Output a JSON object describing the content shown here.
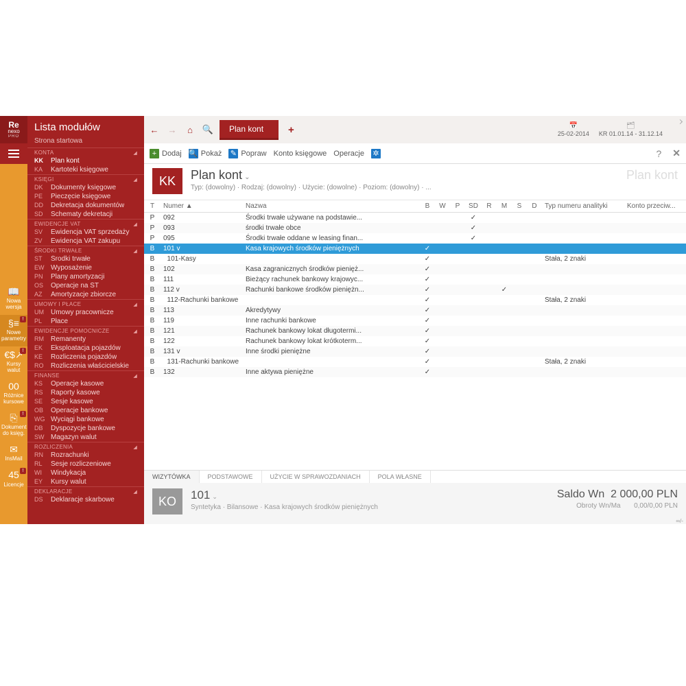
{
  "brand": {
    "name": "Re",
    "line2": "nexo",
    "line3": "PRO"
  },
  "rail": [
    {
      "glyph": "📖",
      "label": "Nowa wersja",
      "badge": false
    },
    {
      "glyph": "§≡",
      "label": "Nowe parametry",
      "badge": true,
      "sel": true
    },
    {
      "glyph": "€$↗",
      "label": "Kursy walut",
      "badge": true
    },
    {
      "glyph": "00",
      "label": "Różnice kursowe",
      "badge": false
    },
    {
      "glyph": "⎘",
      "label": "Dokument do księg.",
      "badge": true
    },
    {
      "glyph": "✉",
      "label": "InsMail",
      "badge": false
    },
    {
      "glyph": "45",
      "label": "Licencje",
      "badge": true
    }
  ],
  "modules": {
    "title": "Lista modułów",
    "start": "Strona startowa",
    "groups": [
      {
        "name": "KONTA",
        "items": [
          {
            "code": "KK",
            "name": "Plan kont",
            "active": true
          },
          {
            "code": "KA",
            "name": "Kartoteki księgowe"
          }
        ]
      },
      {
        "name": "KSIĘGI",
        "items": [
          {
            "code": "DK",
            "name": "Dokumenty księgowe"
          },
          {
            "code": "PE",
            "name": "Pieczęcie księgowe"
          },
          {
            "code": "DD",
            "name": "Dekretacja dokumentów"
          },
          {
            "code": "SD",
            "name": "Schematy dekretacji"
          }
        ]
      },
      {
        "name": "EWIDENCJE VAT",
        "items": [
          {
            "code": "SV",
            "name": "Ewidencja VAT sprzedaży"
          },
          {
            "code": "ZV",
            "name": "Ewidencja VAT zakupu"
          }
        ]
      },
      {
        "name": "ŚRODKI TRWAŁE",
        "items": [
          {
            "code": "ST",
            "name": "Środki trwałe"
          },
          {
            "code": "EW",
            "name": "Wyposażenie"
          },
          {
            "code": "PN",
            "name": "Plany amortyzacji"
          },
          {
            "code": "OS",
            "name": "Operacje na ŚT"
          },
          {
            "code": "AZ",
            "name": "Amortyzacje zbiorcze"
          }
        ]
      },
      {
        "name": "UMOWY I PŁACE",
        "items": [
          {
            "code": "UM",
            "name": "Umowy pracownicze"
          },
          {
            "code": "PL",
            "name": "Płace"
          }
        ]
      },
      {
        "name": "EWIDENCJE POMOCNICZE",
        "items": [
          {
            "code": "RM",
            "name": "Remanenty"
          },
          {
            "code": "EK",
            "name": "Eksploatacja pojazdów"
          },
          {
            "code": "KE",
            "name": "Rozliczenia pojazdów"
          },
          {
            "code": "RO",
            "name": "Rozliczenia właścicielskie"
          }
        ]
      },
      {
        "name": "FINANSE",
        "items": [
          {
            "code": "KS",
            "name": "Operacje kasowe"
          },
          {
            "code": "RS",
            "name": "Raporty kasowe"
          },
          {
            "code": "SE",
            "name": "Sesje kasowe"
          },
          {
            "code": "OB",
            "name": "Operacje bankowe"
          },
          {
            "code": "WG",
            "name": "Wyciągi bankowe"
          },
          {
            "code": "DB",
            "name": "Dyspozycje bankowe"
          },
          {
            "code": "SW",
            "name": "Magazyn walut"
          }
        ]
      },
      {
        "name": "ROZLICZENIA",
        "items": [
          {
            "code": "RN",
            "name": "Rozrachunki"
          },
          {
            "code": "RL",
            "name": "Sesje rozliczeniowe"
          },
          {
            "code": "WI",
            "name": "Windykacja"
          },
          {
            "code": "EY",
            "name": "Kursy walut"
          }
        ]
      },
      {
        "name": "DEKLARACJE",
        "items": [
          {
            "code": "DS",
            "name": "Deklaracje skarbowe"
          }
        ]
      }
    ]
  },
  "topbar": {
    "tab": "Plan kont",
    "date": "25-02-2014",
    "period": "KR  01.01.14 - 31.12.14"
  },
  "toolbar": {
    "add": "Dodaj",
    "show": "Pokaż",
    "fix": "Popraw",
    "konto": "Konto księgowe",
    "oper": "Operacje"
  },
  "header": {
    "badge": "KK",
    "title": "Plan kont",
    "sub": "Typ: (dowolny) · Rodzaj: (dowolny) · Użycie: (dowolne) · Poziom: (dowolny) · ...",
    "ghost": "Plan kont"
  },
  "columns": [
    "T",
    "Numer ▲",
    "Nazwa",
    "B",
    "W",
    "P",
    "SD",
    "R",
    "M",
    "S",
    "D",
    "Typ numeru analityki",
    "Konto przeciw..."
  ],
  "rows": [
    {
      "t": "P",
      "num": "092",
      "name": "Środki trwałe używane na podstawie...",
      "b": "",
      "w": "",
      "p": "",
      "sd": "✓",
      "r": "",
      "m": "",
      "s": "",
      "d": "",
      "typ": "",
      "kp": ""
    },
    {
      "t": "P",
      "num": "093",
      "name": "środki trwałe obce",
      "b": "",
      "w": "",
      "p": "",
      "sd": "✓",
      "r": "",
      "m": "",
      "s": "",
      "d": "",
      "typ": "",
      "kp": ""
    },
    {
      "t": "P",
      "num": "095",
      "name": "Środki trwałe oddane w leasing finan...",
      "b": "",
      "w": "",
      "p": "",
      "sd": "✓",
      "r": "",
      "m": "",
      "s": "",
      "d": "",
      "typ": "",
      "kp": ""
    },
    {
      "t": "B",
      "num": "101 v",
      "name": "Kasa krajowych środków pieniężnych",
      "b": "✓",
      "w": "",
      "p": "",
      "sd": "",
      "r": "",
      "m": "",
      "s": "",
      "d": "",
      "typ": "",
      "kp": "",
      "sel": true
    },
    {
      "t": "B",
      "num": "  101-Kasy",
      "name": "",
      "b": "✓",
      "w": "",
      "p": "",
      "sd": "",
      "r": "",
      "m": "",
      "s": "",
      "d": "",
      "typ": "Stała, 2 znaki",
      "kp": ""
    },
    {
      "t": "B",
      "num": "102",
      "name": "Kasa zagranicznych środków pienięż...",
      "b": "✓",
      "w": "",
      "p": "",
      "sd": "",
      "r": "",
      "m": "",
      "s": "",
      "d": "",
      "typ": "",
      "kp": ""
    },
    {
      "t": "B",
      "num": "111",
      "name": "Bieżący rachunek bankowy krajowyc...",
      "b": "✓",
      "w": "",
      "p": "",
      "sd": "",
      "r": "",
      "m": "",
      "s": "",
      "d": "",
      "typ": "",
      "kp": ""
    },
    {
      "t": "B",
      "num": "112 v",
      "name": "Rachunki bankowe środków pieniężn...",
      "b": "✓",
      "w": "",
      "p": "",
      "sd": "",
      "r": "",
      "m": "✓",
      "s": "",
      "d": "",
      "typ": "",
      "kp": ""
    },
    {
      "t": "B",
      "num": "  112-Rachunki bankowe",
      "name": "",
      "b": "✓",
      "w": "",
      "p": "",
      "sd": "",
      "r": "",
      "m": "",
      "s": "",
      "d": "",
      "typ": "Stała, 2 znaki",
      "kp": ""
    },
    {
      "t": "B",
      "num": "113",
      "name": "Akredytywy",
      "b": "✓",
      "w": "",
      "p": "",
      "sd": "",
      "r": "",
      "m": "",
      "s": "",
      "d": "",
      "typ": "",
      "kp": ""
    },
    {
      "t": "B",
      "num": "119",
      "name": "Inne rachunki bankowe",
      "b": "✓",
      "w": "",
      "p": "",
      "sd": "",
      "r": "",
      "m": "",
      "s": "",
      "d": "",
      "typ": "",
      "kp": ""
    },
    {
      "t": "B",
      "num": "121",
      "name": "Rachunek bankowy lokat długotermi...",
      "b": "✓",
      "w": "",
      "p": "",
      "sd": "",
      "r": "",
      "m": "",
      "s": "",
      "d": "",
      "typ": "",
      "kp": ""
    },
    {
      "t": "B",
      "num": "122",
      "name": "Rachunek bankowy lokat krótkoterm...",
      "b": "✓",
      "w": "",
      "p": "",
      "sd": "",
      "r": "",
      "m": "",
      "s": "",
      "d": "",
      "typ": "",
      "kp": ""
    },
    {
      "t": "B",
      "num": "131 v",
      "name": "Inne środki pieniężne",
      "b": "✓",
      "w": "",
      "p": "",
      "sd": "",
      "r": "",
      "m": "",
      "s": "",
      "d": "",
      "typ": "",
      "kp": ""
    },
    {
      "t": "B",
      "num": "  131-Rachunki bankowe",
      "name": "",
      "b": "✓",
      "w": "",
      "p": "",
      "sd": "",
      "r": "",
      "m": "",
      "s": "",
      "d": "",
      "typ": "Stała, 2 znaki",
      "kp": ""
    },
    {
      "t": "B",
      "num": "132",
      "name": "Inne aktywa pieniężne",
      "b": "✓",
      "w": "",
      "p": "",
      "sd": "",
      "r": "",
      "m": "",
      "s": "",
      "d": "",
      "typ": "",
      "kp": ""
    }
  ],
  "detailTabs": [
    "WIZYTÓWKA",
    "PODSTAWOWE",
    "UŻYCIE W SPRAWOZDANIACH",
    "POLA WŁASNE"
  ],
  "detail": {
    "badge": "KO",
    "title": "101",
    "sub": "Syntetyka · Bilansowe · Kasa krajowych środków pieniężnych",
    "amtLabel": "Saldo Wn",
    "amtVal": "2 000,00 PLN",
    "amt2Label": "Obroty Wn/Ma",
    "amt2Val": "0,00/0,00 PLN",
    "toggle": "∞/-"
  }
}
